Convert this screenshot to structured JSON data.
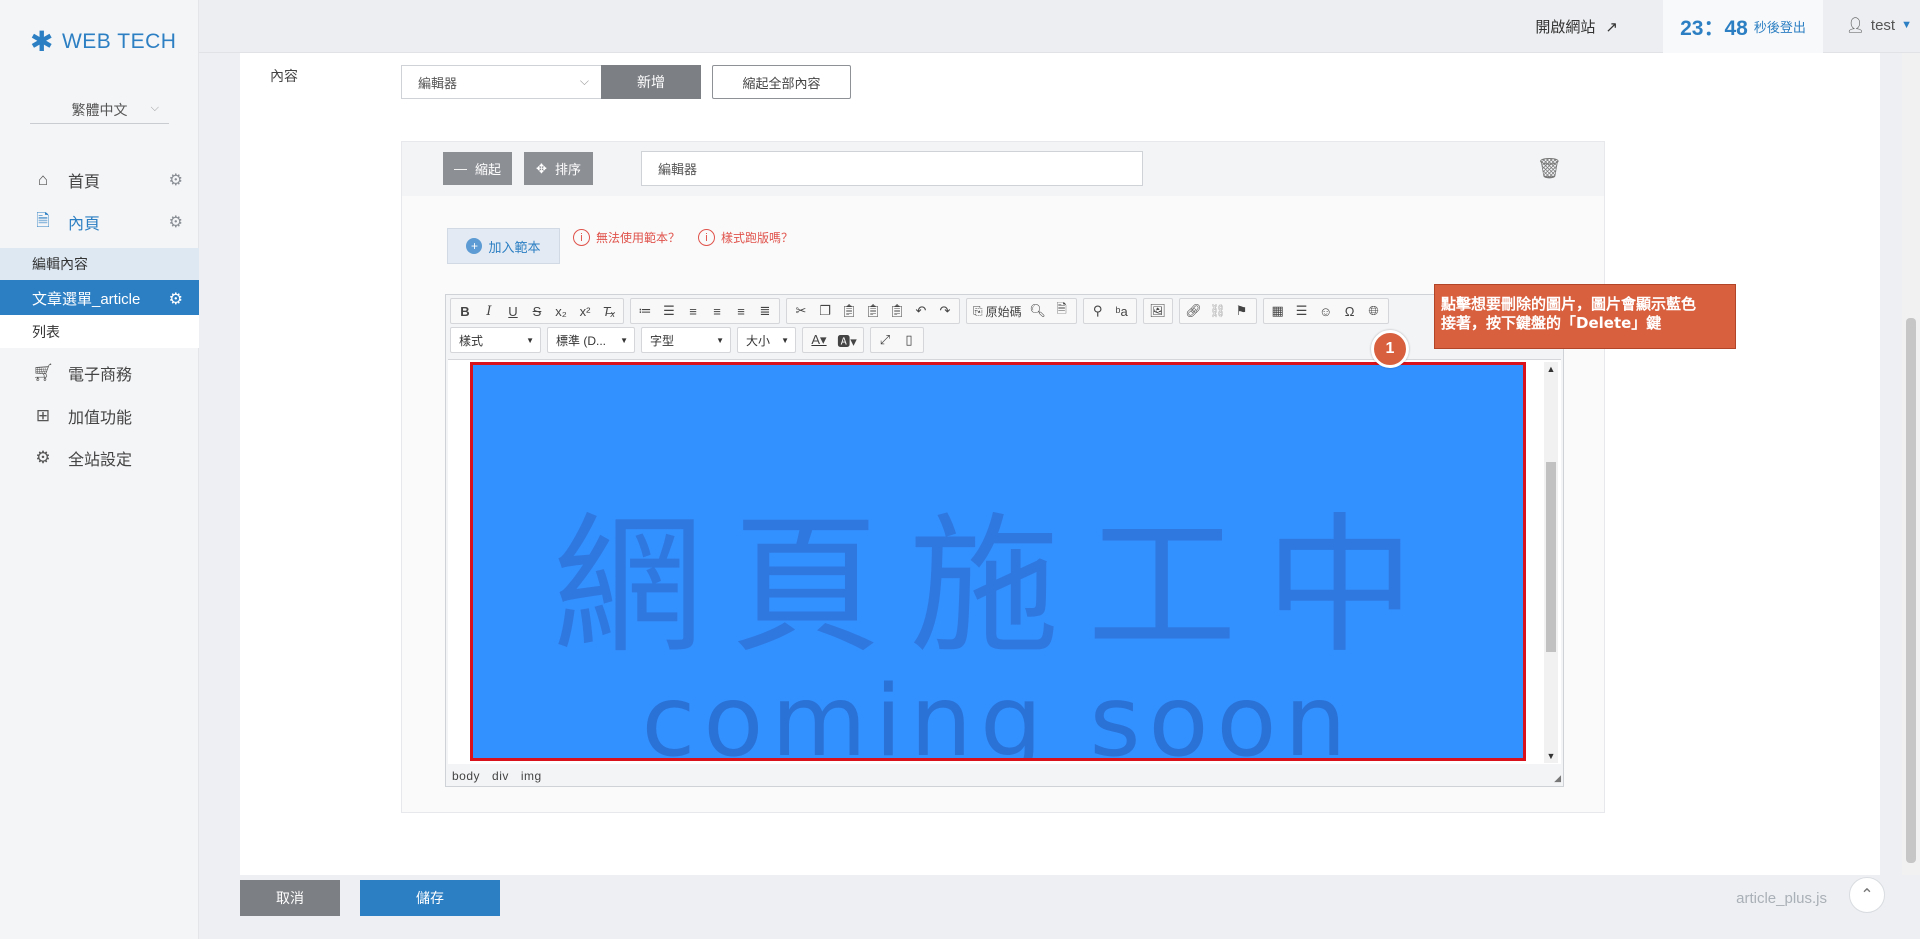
{
  "brand": {
    "name": "WEB TECH",
    "color": "#2c7fc3"
  },
  "sidebar": {
    "language": "繁體中文",
    "items": [
      {
        "label": "首頁",
        "icon": "home-icon"
      },
      {
        "label": "內頁",
        "icon": "document-icon"
      },
      {
        "label": "電子商務",
        "icon": "cart-icon"
      },
      {
        "label": "加值功能",
        "icon": "gift-icon"
      },
      {
        "label": "全站設定",
        "icon": "gear-icon"
      }
    ],
    "submenu": [
      {
        "label": "編輯內容"
      },
      {
        "label": "文章選單_article"
      },
      {
        "label": "列表"
      }
    ]
  },
  "topbar": {
    "open_site": "開啟網站",
    "timer_value": "23：48",
    "timer_suffix": "秒後登出",
    "user": "test"
  },
  "form": {
    "field_label": "內容",
    "editor_select": "編輯器",
    "add_button": "新增",
    "collapse_all_button": "縮起全部內容",
    "block": {
      "collapse_button": "縮起",
      "sort_button": "排序",
      "title_value": "編輯器",
      "add_template_button": "加入範本",
      "help_template": "無法使用範本？",
      "help_layout": "樣式跑版嗎？"
    },
    "editor": {
      "source_button": "原始碼",
      "combo_style": "樣式",
      "combo_format": "標準 (D...",
      "combo_font": "字型",
      "combo_size": "大小",
      "image_text_main": "網頁施工中",
      "image_text_sub": "coming soon",
      "path": [
        "body",
        "div",
        "img"
      ]
    }
  },
  "annotation": {
    "number": "1",
    "line1": "點擊想要刪除的圖片，圖片會顯示藍色",
    "line2": "接著，按下鍵盤的「Delete」鍵"
  },
  "footer": {
    "cancel_button": "取消",
    "save_button": "儲存",
    "filename": "article_plus.js"
  }
}
